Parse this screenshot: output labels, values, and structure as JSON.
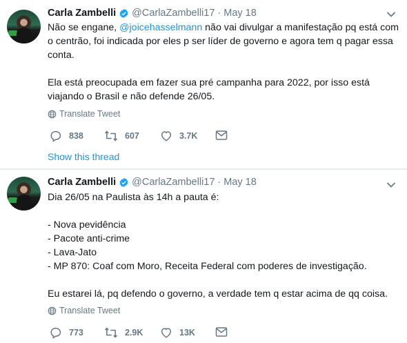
{
  "tweets": [
    {
      "author_name": "Carla Zambelli",
      "handle": "@CarlaZambelli17",
      "separator": "·",
      "date": "May 18",
      "text_intro": "Não se engane, ",
      "mention": "@joicehasselmann",
      "text_rest": " não vai divulgar a manifestação pq está com o centrão, foi indicada por eles p ser líder de governo e agora tem q pagar essa conta.",
      "text_para2": "Ela está preocupada em fazer sua pré campanha para 2022, por isso está viajando o Brasil e não defende 26/05.",
      "translate_label": "Translate Tweet",
      "replies": "838",
      "retweets": "607",
      "likes": "3.7K",
      "show_thread": "Show this thread"
    },
    {
      "author_name": "Carla Zambelli",
      "handle": "@CarlaZambelli17",
      "separator": "·",
      "date": "May 18",
      "lines": [
        "Dia 26/05 na Paulista às 14h a pauta é:",
        "",
        "- Nova pevidência",
        "- Pacote anti-crime",
        "- Lava-Jato",
        "- MP 870: Coaf com Moro, Receita Federal com poderes de investigação.",
        "",
        "Eu estarei lá, pq defendo o governo, a verdade tem q estar acima de qq coisa."
      ],
      "translate_label": "Translate Tweet",
      "replies": "773",
      "retweets": "2.9K",
      "likes": "13K"
    }
  ],
  "colors": {
    "link": "#1b95e0",
    "muted": "#657786",
    "text": "#14171a",
    "verified": "#1da1f2"
  },
  "icons": [
    "verified-badge-icon",
    "chevron-down-icon",
    "globe-icon",
    "reply-icon",
    "retweet-icon",
    "like-icon",
    "message-icon"
  ]
}
